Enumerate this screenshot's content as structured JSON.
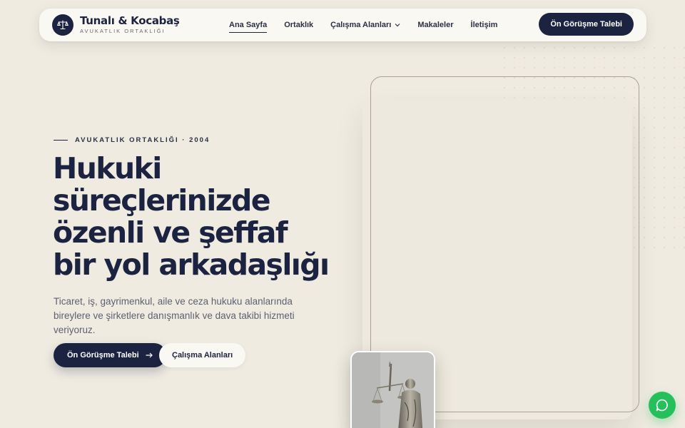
{
  "brand": {
    "name": "Tunalı & Kocabaş",
    "subtitle": "AVUKATLIK ORTAKLIĞI",
    "logo_icon": "scales-icon"
  },
  "nav": {
    "links": [
      {
        "label": "Ana Sayfa",
        "active": true
      },
      {
        "label": "Ortaklık",
        "active": false
      },
      {
        "label": "Çalışma Alanları",
        "active": false,
        "has_dropdown": true
      },
      {
        "label": "Makaleler",
        "active": false
      },
      {
        "label": "İletişim",
        "active": false
      }
    ],
    "cta_label": "Ön Görüşme Talebi"
  },
  "hero": {
    "eyebrow": "AVUKATLIK ORTAKLIĞI · 2004",
    "title_lines": [
      "Hukuki",
      "süreçlerinizde",
      "özenli ve şeffaf",
      "bir yol arkadaşlığı"
    ],
    "description": "Ticaret, iş, gayrimenkul, aile ve ceza hukuku alanlarında bireylere ve şirketlere danışmanlık ve dava takibi hizmeti veriyoruz.",
    "primary_button": "Ön Görüşme Talebi",
    "secondary_button": "Çalışma Alanları"
  },
  "chat": {
    "icon": "chat-bubble-icon"
  },
  "colors": {
    "background": "#efebe1",
    "navy": "#1c2340",
    "chat_green": "#25c05b"
  }
}
